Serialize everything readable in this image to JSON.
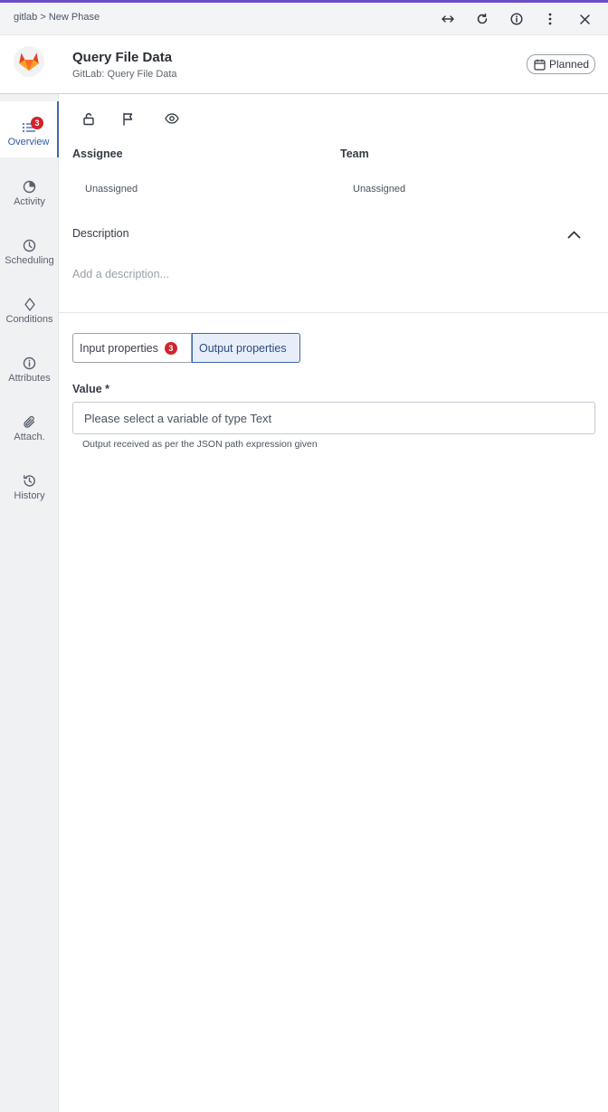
{
  "breadcrumb": "gitlab > New Phase",
  "header": {
    "title": "Query File Data",
    "subtitle": "GitLab: Query File Data",
    "status": "Planned"
  },
  "sidebar": {
    "items": [
      {
        "label": "Overview",
        "icon": "list-icon",
        "badge": "3",
        "active": true
      },
      {
        "label": "Activity",
        "icon": "pie-chart-icon"
      },
      {
        "label": "Scheduling",
        "icon": "clock-icon"
      },
      {
        "label": "Conditions",
        "icon": "diamond-icon"
      },
      {
        "label": "Attributes",
        "icon": "info-icon"
      },
      {
        "label": "Attach.",
        "icon": "paperclip-icon"
      },
      {
        "label": "History",
        "icon": "history-icon"
      }
    ]
  },
  "fields": {
    "assignee_label": "Assignee",
    "assignee_value": "Unassigned",
    "team_label": "Team",
    "team_value": "Unassigned"
  },
  "description": {
    "title": "Description",
    "placeholder": "Add a description..."
  },
  "tabs": {
    "input_label": "Input properties",
    "input_badge": "3",
    "output_label": "Output properties"
  },
  "output": {
    "value_label": "Value *",
    "placeholder": "Please select a variable of type Text",
    "helper": "Output received as per the JSON path expression given"
  },
  "colors": {
    "accent": "#6b4fc8",
    "active_blue": "#3f66b0",
    "badge_red": "#d3222a",
    "gitlab_orange": "#e24329"
  }
}
